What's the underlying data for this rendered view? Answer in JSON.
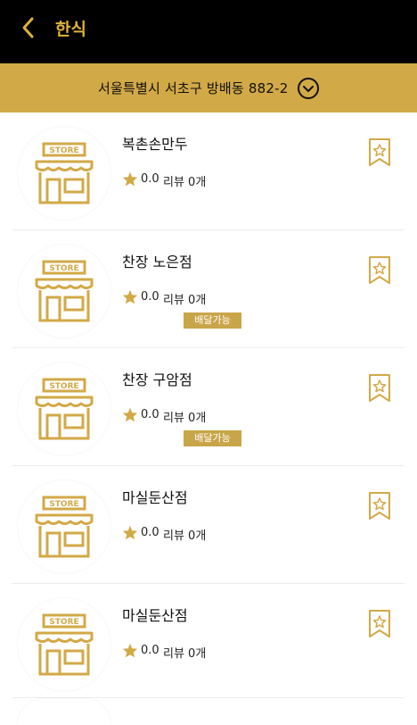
{
  "header": {
    "title": "한식",
    "back_icon": "chevron-left-icon"
  },
  "address": {
    "text": "서울특별시 서초구 방배동 882-2",
    "dropdown_icon": "chevron-down-circle-icon"
  },
  "theme": {
    "accent": "#d2a947",
    "header_bg": "#000000",
    "title_color": "#e0b23c",
    "badge_bg": "#c9a54a"
  },
  "stores": [
    {
      "name": "복촌손만두",
      "rating": "0.0",
      "review_label": "리뷰 0개",
      "badge": ""
    },
    {
      "name": "찬장 노은점",
      "rating": "0.0",
      "review_label": "리뷰 0개",
      "badge": "배달가능"
    },
    {
      "name": "찬장 구암점",
      "rating": "0.0",
      "review_label": "리뷰 0개",
      "badge": "배달가능"
    },
    {
      "name": "마실둔산점",
      "rating": "0.0",
      "review_label": "리뷰 0개",
      "badge": ""
    },
    {
      "name": "마실둔산점",
      "rating": "0.0",
      "review_label": "리뷰 0개",
      "badge": ""
    }
  ],
  "icons": {
    "store": "store-icon",
    "star": "star-icon",
    "bookmark": "bookmark-star-icon"
  },
  "store_sign": "STORE"
}
